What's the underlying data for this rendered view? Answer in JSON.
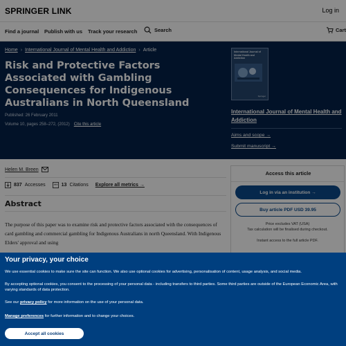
{
  "header": {
    "logo": "SPRINGER LINK",
    "login_label": "Log in"
  },
  "nav": {
    "find_journal": "Find a journal",
    "publish": "Publish with us",
    "track": "Track your research",
    "search": "Search",
    "cart": "Cart"
  },
  "breadcrumb": {
    "home": "Home",
    "journal": "International Journal of Mental Health and Addiction",
    "current": "Article"
  },
  "article": {
    "title": "Risk and Protective Factors Associated with Gambling Consequences for Indigenous Australians in North Queensland",
    "published": "Published: 26 February 2011",
    "volume": "Volume 10, pages 258–272, (2012)",
    "cite_label": "Cite this article",
    "author": "Helen M. Breen",
    "accesses_count": "837",
    "accesses_label": "Accesses",
    "citations_count": "13",
    "citations_label": "Citations",
    "all_metrics": "Explore all metrics →",
    "abstract_heading": "Abstract",
    "abstract_text": "The purpose of this paper was to examine risk and protective factors associated with the consequences of card gambling and commercial gambling for Indigenous Australians in north Queensland. With Indigenous Elders' approval and using"
  },
  "journal_panel": {
    "cover_title": "International Journal of Mental Health and Addiction",
    "cover_publisher": "Springer",
    "journal_name": "International Journal of Mental Health and Addiction",
    "aims_label": "Aims and scope →",
    "submit_label": "Submit manuscript →"
  },
  "access_box": {
    "heading": "Access this article",
    "login_button": "Log in via an institution →",
    "buy_button": "Buy article PDF USD 39.95",
    "price_note_1": "Price excludes VAT (USA)",
    "price_note_2": "Tax calculation will be finalised during checkout.",
    "instant": "Instant access to the full article PDF."
  },
  "cookie": {
    "heading": "Your privacy, your choice",
    "p1": "We use essential cookies to make sure the site can function. We also use optional cookies for advertising, personalisation of content, usage analysis, and social media.",
    "p2": "By accepting optional cookies, you consent to the processing of your personal data - including transfers to third parties. Some third parties are outside of the European Economic Area, with varying standards of data protection.",
    "p3_before": "See our",
    "p3_link": "privacy policy",
    "p3_after": "for more information on the use of your personal data.",
    "p4_link": "Manage preferences",
    "p4_after": "for further information and to change your choices.",
    "accept_button": "Accept all cookies"
  },
  "colors": {
    "hero_bg": "#04224a",
    "cookie_bg": "#003f7f",
    "accent": "#0b4a8a"
  },
  "icons": {
    "search": "search-icon",
    "cart": "cart-icon",
    "email": "email-icon",
    "accesses": "download-icon",
    "citations": "quote-icon"
  }
}
